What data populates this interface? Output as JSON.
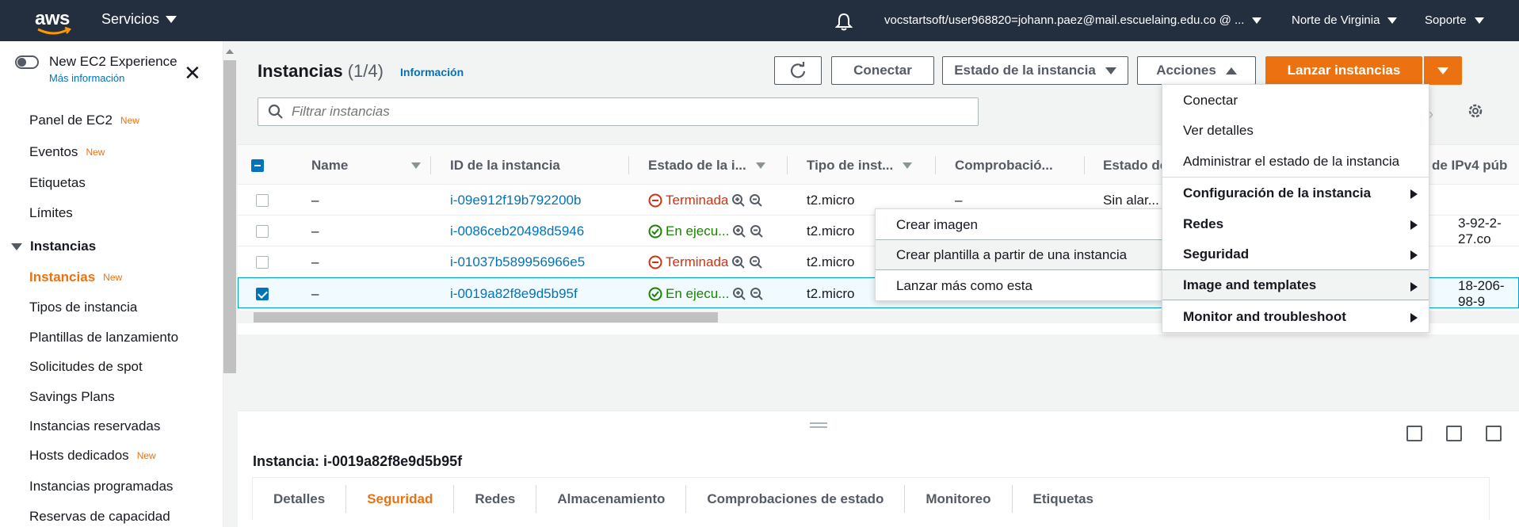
{
  "nav": {
    "logo": "aws",
    "services": "Servicios",
    "user": "vocstartsoft/user968820=johann.paez@mail.escuelaing.edu.co @ ...",
    "region": "Norte de Virginia",
    "support": "Soporte"
  },
  "sidebar": {
    "experience_title": "New EC2 Experience",
    "experience_link": "Más información",
    "new_badge": "New",
    "items_top": [
      {
        "label": "Panel de EC2",
        "new": true
      },
      {
        "label": "Eventos",
        "new": true
      },
      {
        "label": "Etiquetas",
        "new": false
      },
      {
        "label": "Límites",
        "new": false
      }
    ],
    "section": "Instancias",
    "items_section": [
      {
        "label": "Instancias",
        "new": true,
        "active": true
      },
      {
        "label": "Tipos de instancia",
        "new": false
      },
      {
        "label": "Plantillas de lanzamiento",
        "new": false
      },
      {
        "label": "Solicitudes de spot",
        "new": false
      },
      {
        "label": "Savings Plans",
        "new": false
      },
      {
        "label": "Instancias reservadas",
        "new": false
      },
      {
        "label": "Hosts dedicados",
        "new": true
      },
      {
        "label": "Instancias programadas",
        "new": false
      },
      {
        "label": "Reservas de capacidad",
        "new": false
      }
    ]
  },
  "main": {
    "title": "Instancias",
    "count": "(1/4)",
    "info": "Información",
    "btn_connect": "Conectar",
    "btn_state": "Estado de la instancia",
    "btn_actions": "Acciones",
    "btn_launch": "Lanzar instancias",
    "search_placeholder": "Filtrar instancias"
  },
  "table": {
    "headers": [
      "Name",
      "ID de la instancia",
      "Estado de la i...",
      "Tipo de inst...",
      "Comprobació...",
      "Estado de",
      "de IPv4 púb"
    ],
    "rows": [
      {
        "name": "–",
        "id": "i-09e912f19b792200b",
        "state": "Terminada",
        "state_kind": "terminated",
        "type": "t2.micro",
        "check": "–",
        "alarm": "Sin alar...",
        "ip": "",
        "selected": false
      },
      {
        "name": "–",
        "id": "i-0086ceb20498d5946",
        "state": "En ejecu...",
        "state_kind": "running",
        "type": "t2.micro",
        "check": "",
        "alarm": "",
        "ip": "3-92-2-27.co",
        "selected": false
      },
      {
        "name": "–",
        "id": "i-01037b589956966e5",
        "state": "Terminada",
        "state_kind": "terminated",
        "type": "t2.micro",
        "check": "",
        "alarm": "",
        "ip": "",
        "selected": false
      },
      {
        "name": "–",
        "id": "i-0019a82f8e9d5b95f",
        "state": "En ejecu...",
        "state_kind": "running",
        "type": "t2.micro",
        "check": "",
        "alarm": "",
        "ip": "18-206-98-9",
        "selected": true
      }
    ]
  },
  "actions_menu": [
    {
      "label": "Conectar",
      "bold": false,
      "submenu": false
    },
    {
      "label": "Ver detalles",
      "bold": false,
      "submenu": false
    },
    {
      "label": "Administrar el estado de la instancia",
      "bold": false,
      "submenu": false
    },
    {
      "label": "Configuración de la instancia",
      "bold": true,
      "submenu": true
    },
    {
      "label": "Redes",
      "bold": true,
      "submenu": true
    },
    {
      "label": "Seguridad",
      "bold": true,
      "submenu": true
    },
    {
      "label": "Image and templates",
      "bold": true,
      "submenu": true,
      "highlighted": true
    },
    {
      "label": "Monitor and troubleshoot",
      "bold": true,
      "submenu": true
    }
  ],
  "sub_menu": [
    {
      "label": "Crear imagen"
    },
    {
      "label": "Crear plantilla a partir de una instancia",
      "highlighted": true
    },
    {
      "label": "Lanzar más como esta"
    }
  ],
  "details": {
    "title": "Instancia: i-0019a82f8e9d5b95f",
    "tabs": [
      "Detalles",
      "Seguridad",
      "Redes",
      "Almacenamiento",
      "Comprobaciones de estado",
      "Monitoreo",
      "Etiquetas"
    ],
    "active_tab": "Seguridad"
  },
  "colors": {
    "nav_bg": "#232f3e",
    "accent": "#ec7211",
    "link": "#0073bb",
    "terminated": "#d13212",
    "running": "#1d8102"
  }
}
